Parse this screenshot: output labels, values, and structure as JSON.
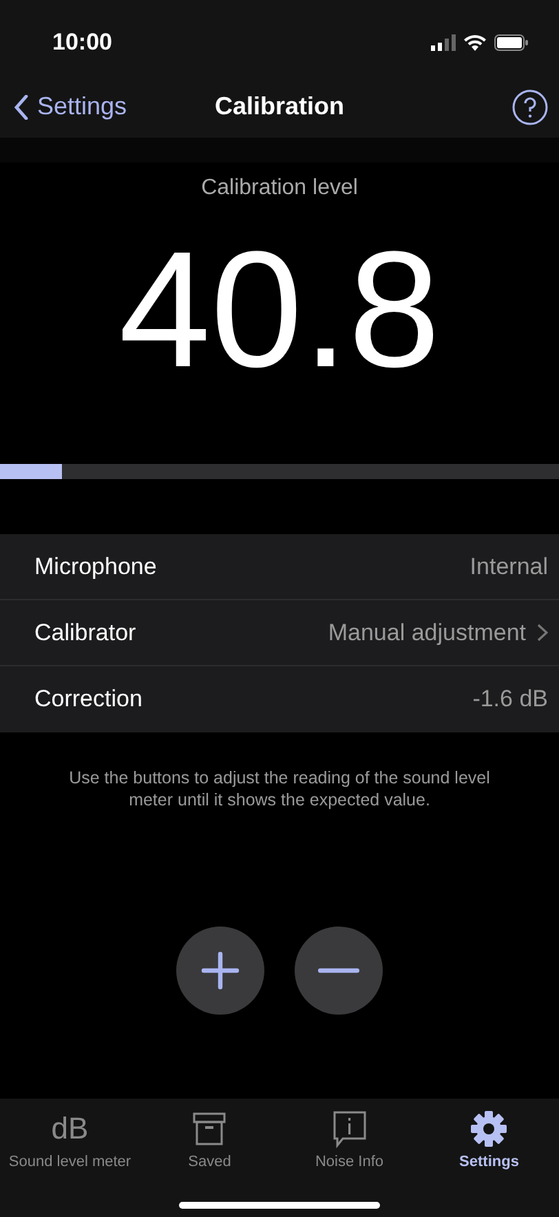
{
  "status_bar": {
    "time": "10:00"
  },
  "nav": {
    "back": "Settings",
    "title": "Calibration"
  },
  "meter": {
    "label": "Calibration level",
    "value": "40.8",
    "level": 0.11
  },
  "settings": [
    {
      "label": "Microphone",
      "value": "Internal",
      "kind": "value"
    },
    {
      "label": "Calibrator",
      "value": "Manual adjustment",
      "kind": "link"
    },
    {
      "label": "Correction",
      "value": "-1.6 dB",
      "kind": "value"
    }
  ],
  "note": "Use the buttons to adjust the reading of the sound level meter until it shows the expected value.",
  "adjust_buttons": [
    {
      "kind": "plus"
    },
    {
      "kind": "minus"
    }
  ],
  "tabs": [
    {
      "label": "Sound level meter",
      "kind": "text",
      "icon_text": "dB",
      "selected": false
    },
    {
      "label": "Saved",
      "kind": "box",
      "selected": false
    },
    {
      "label": "Noise Info",
      "kind": "info",
      "selected": false
    },
    {
      "label": "Settings",
      "kind": "gear",
      "selected": true
    }
  ]
}
